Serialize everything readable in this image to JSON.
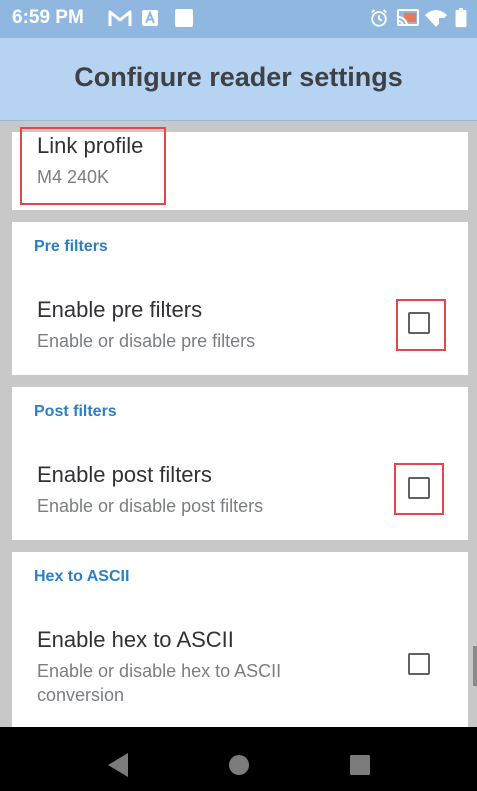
{
  "status_bar": {
    "time": "6:59 PM",
    "left_icons": [
      "gmail-icon",
      "app-a-icon",
      "square-app-icon"
    ],
    "right_icons": [
      "alarm-icon",
      "cast-icon",
      "wifi-icon",
      "battery-icon"
    ]
  },
  "header": {
    "title": "Configure reader settings"
  },
  "link_profile": {
    "title": "Link profile",
    "value": "M4 240K"
  },
  "pre_filters": {
    "section": "Pre filters",
    "title": "Enable pre filters",
    "summary": "Enable or disable pre filters",
    "checked": false
  },
  "post_filters": {
    "section": "Post filters",
    "title": "Enable post filters",
    "summary": "Enable or disable post filters",
    "checked": false
  },
  "hex_to_ascii": {
    "section": "Hex to ASCII",
    "title": "Enable hex to ASCII",
    "summary": "Enable or disable hex to ASCII conversion",
    "checked": false
  },
  "nav_bar": {
    "icons": [
      "back-icon",
      "home-icon",
      "recents-icon"
    ]
  },
  "colors": {
    "accent": "#2b7fc4",
    "header_bg": "#b7d3f2",
    "highlight": "#e2474f"
  }
}
